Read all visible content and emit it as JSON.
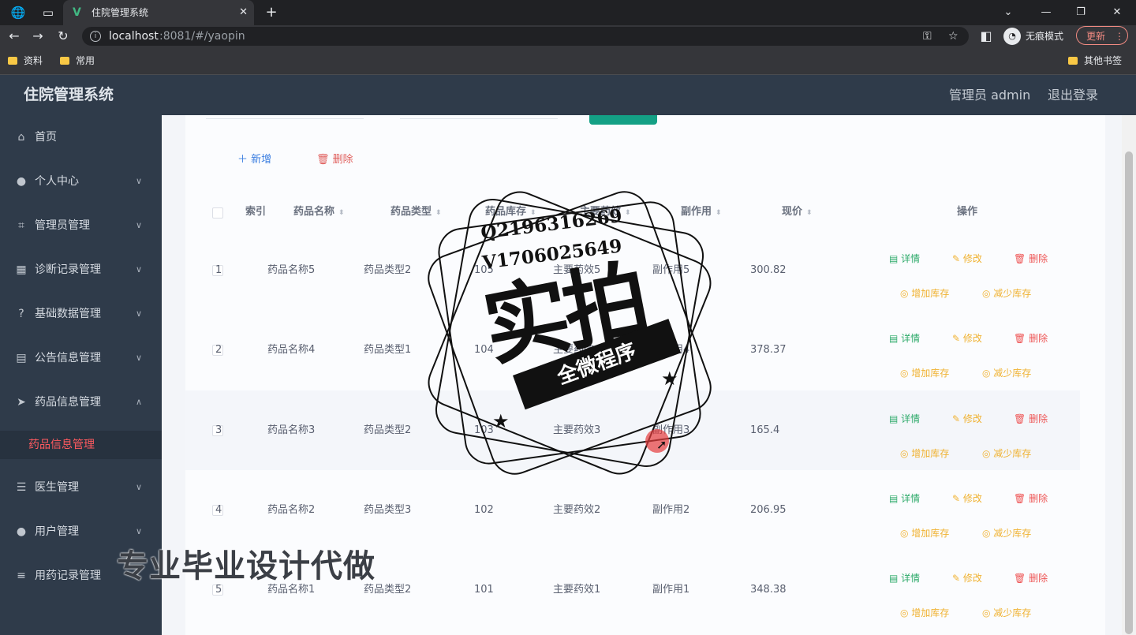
{
  "browser": {
    "tab_title": "住院管理系统",
    "tab_logo": "V",
    "url_host": "localhost",
    "url_path": ":8081/#/yaopin",
    "incognito_label": "无痕模式",
    "update_label": "更新",
    "bookmarks": [
      {
        "label": "资料"
      },
      {
        "label": "常用"
      }
    ],
    "other_bookmarks": "其他书签"
  },
  "app": {
    "title": "住院管理系统",
    "admin_label": "管理员 admin",
    "logout_label": "退出登录"
  },
  "sidebar": {
    "items": [
      {
        "label": "首页",
        "icon": "home-icon"
      },
      {
        "label": "个人中心",
        "icon": "user-icon"
      },
      {
        "label": "管理员管理",
        "icon": "crop-icon"
      },
      {
        "label": "诊断记录管理",
        "icon": "grid-icon"
      },
      {
        "label": "基础数据管理",
        "icon": "help-icon"
      },
      {
        "label": "公告信息管理",
        "icon": "calendar-icon"
      },
      {
        "label": "药品信息管理",
        "icon": "send-icon"
      },
      {
        "label": "医生管理",
        "icon": "sliders-icon"
      },
      {
        "label": "用户管理",
        "icon": "user-icon"
      },
      {
        "label": "用药记录管理",
        "icon": "list-icon"
      }
    ],
    "active_submenu": "药品信息管理"
  },
  "toolbar": {
    "add_label": "新增",
    "delete_label": "删除"
  },
  "table": {
    "headers": [
      "索引",
      "药品名称",
      "药品类型",
      "药品库存",
      "主要药效",
      "副作用",
      "现价",
      "操作"
    ],
    "rows": [
      {
        "index": "1",
        "name": "药品名称5",
        "type": "药品类型2",
        "stock": "105",
        "effect": "主要药效5",
        "side": "副作用5",
        "price": "300.82"
      },
      {
        "index": "2",
        "name": "药品名称4",
        "type": "药品类型1",
        "stock": "104",
        "effect": "主要药效4",
        "side": "副作用4",
        "price": "378.37"
      },
      {
        "index": "3",
        "name": "药品名称3",
        "type": "药品类型2",
        "stock": "103",
        "effect": "主要药效3",
        "side": "副作用3",
        "price": "165.4"
      },
      {
        "index": "4",
        "name": "药品名称2",
        "type": "药品类型3",
        "stock": "102",
        "effect": "主要药效2",
        "side": "副作用2",
        "price": "206.95"
      },
      {
        "index": "5",
        "name": "药品名称1",
        "type": "药品类型2",
        "stock": "101",
        "effect": "主要药效1",
        "side": "副作用1",
        "price": "348.38"
      }
    ],
    "ops": {
      "detail": "详情",
      "edit": "修改",
      "delete": "删除",
      "add_stock": "增加库存",
      "reduce_stock": "减少库存"
    }
  },
  "watermark": {
    "qq": "Q2196316269",
    "vx": "V1706025649",
    "big": "实拍",
    "banner": "全微程序",
    "caption": "专业毕业设计代做"
  }
}
